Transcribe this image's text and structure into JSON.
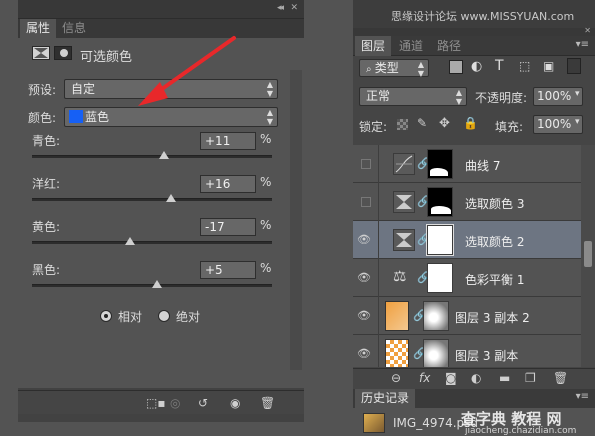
{
  "properties_panel": {
    "tabs": [
      "属性",
      "信息"
    ],
    "title": "可选颜色",
    "preset_label": "预设:",
    "preset_value": "自定",
    "colors_label": "颜色:",
    "colors_value": "蓝色",
    "colors_swatch": "#1660f5",
    "sliders": [
      {
        "label": "青色:",
        "value": "+11",
        "unit": "%",
        "fraction": 0.55
      },
      {
        "label": "洋红:",
        "value": "+16",
        "unit": "%",
        "fraction": 0.58
      },
      {
        "label": "黄色:",
        "value": "-17",
        "unit": "%",
        "fraction": 0.41
      },
      {
        "label": "黑色:",
        "value": "+5",
        "unit": "%",
        "fraction": 0.52
      }
    ],
    "method_relative": "相对",
    "method_absolute": "绝对",
    "method_selected": "relative"
  },
  "layers_panel": {
    "watermark_top": "思缘设计论坛 www.MISSYUAN.com",
    "tabs": [
      "图层",
      "通道",
      "路径"
    ],
    "filter_type": "类型",
    "blend_mode": "正常",
    "opacity_label": "不透明度:",
    "opacity_value": "100%",
    "lock_label": "锁定:",
    "fill_label": "填充:",
    "fill_value": "100%",
    "layers": [
      {
        "name": "曲线 7",
        "visible": false,
        "selected": false
      },
      {
        "name": "选取颜色 3",
        "visible": false,
        "selected": false
      },
      {
        "name": "选取颜色 2",
        "visible": true,
        "selected": true
      },
      {
        "name": "色彩平衡 1",
        "visible": true,
        "selected": false
      },
      {
        "name": "图层 3 副本 2",
        "visible": true,
        "selected": false
      },
      {
        "name": "图层 3 副本",
        "visible": true,
        "selected": false
      }
    ],
    "history_tab": "历史记录",
    "history_item": "IMG_4974.psd",
    "watermark_bottom": "查字典 教程 网",
    "watermark_bottom_url": "jiaocheng.chazidian.com"
  },
  "accent": {
    "arrow": "#e8282a",
    "selected_row": "#6d7582"
  }
}
